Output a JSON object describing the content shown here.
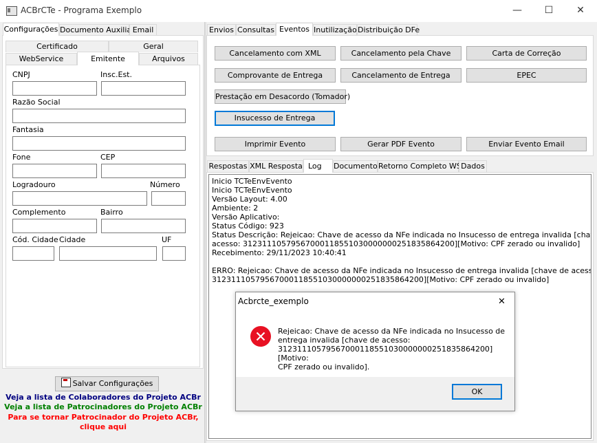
{
  "window": {
    "title": "ACBrCTe - Programa Exemplo",
    "minimize": "—",
    "maximize": "☐",
    "close": "✕"
  },
  "left": {
    "tabs": [
      "Configurações",
      "Documento Auxiliar",
      "Email"
    ],
    "subtabs_row1": [
      "Certificado",
      "Geral"
    ],
    "subtabs_row2": [
      "WebService",
      "Emitente",
      "Arquivos"
    ],
    "fields": {
      "cnpj": "CNPJ",
      "ie": "Insc.Est.",
      "razao": "Razão Social",
      "fantasia": "Fantasia",
      "fone": "Fone",
      "cep": "CEP",
      "logradouro": "Logradouro",
      "numero": "Número",
      "complemento": "Complemento",
      "bairro": "Bairro",
      "cod_cidade": "Cód. Cidade",
      "cidade": "Cidade",
      "uf": "UF"
    },
    "save_button": "Salvar Configurações",
    "links": {
      "colaboradores": "Veja a lista de Colaboradores do Projeto ACBr",
      "patrocinadores": "Veja a lista de Patrocinadores do Projeto ACBr",
      "tornar1": "Para se tornar Patrocinador do Projeto ACBr,",
      "tornar2": "clique aqui"
    },
    "colors": {
      "blue": "#000080",
      "green": "#008000",
      "red": "#ff0000"
    }
  },
  "right": {
    "tabs": [
      "Envios",
      "Consultas",
      "Eventos",
      "Inutilização",
      "Distribuição DFe"
    ],
    "buttons": {
      "canc_xml": "Cancelamento com XML",
      "canc_chave": "Cancelamento pela Chave",
      "carta": "Carta de Correção",
      "comprovante": "Comprovante de Entrega",
      "canc_entrega": "Cancelamento de Entrega",
      "epec": "EPEC",
      "prestacao": "Prestação em Desacordo (Tomador)",
      "insucesso": "Insucesso de Entrega",
      "imprimir": "Imprimir Evento",
      "gerar_pdf": "Gerar PDF Evento",
      "enviar_email": "Enviar Evento Email"
    },
    "result_tabs": [
      "Respostas",
      "XML Resposta",
      "Log",
      "Documento",
      "Retorno Completo WS",
      "Dados"
    ],
    "log_lines": [
      "Inicio TCTeEnvEvento",
      "Inicio TCTeEnvEvento",
      "Versão Layout: 4.00",
      "Ambiente: 2",
      "Versão Aplicativo:",
      "Status Código: 923",
      "Status Descrição: Rejeicao: Chave de acesso da NFe indicada no Insucesso de entrega invalida [chave de",
      "acesso: 31231110579567000118551030000000251835864200][Motivo: CPF zerado ou invalido]",
      "Recebimento: 29/11/2023 10:40:41",
      "",
      "ERRO: Rejeicao: Chave de acesso da NFe indicada no Insucesso de entrega invalida [chave de acesso:",
      "31231110579567000118551030000000251835864200][Motivo: CPF zerado ou invalido]"
    ]
  },
  "dialog": {
    "title": "Acbrcte_exemplo",
    "close": "✕",
    "message_lines": [
      "Rejeicao: Chave de acesso da NFe indicada no Insucesso de",
      "entrega invalida [chave de acesso:",
      "31231110579567000118551030000000251835864200][Motivo:",
      "CPF zerado ou invalido]."
    ],
    "ok": "OK",
    "icon": "error-icon"
  }
}
